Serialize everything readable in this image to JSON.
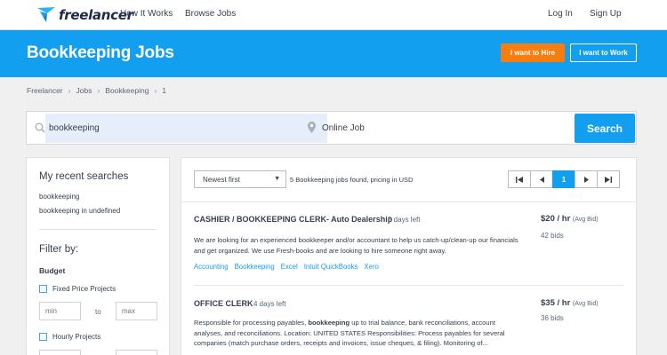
{
  "nav": {
    "logo_text": "freelancer",
    "links": [
      "How It Works",
      "Browse Jobs"
    ],
    "login": "Log In",
    "signup": "Sign Up"
  },
  "banner": {
    "title": "Bookkeeping Jobs",
    "hire_label": "I want to Hire",
    "work_label": "I want to Work"
  },
  "breadcrumb": [
    "Freelancer",
    "Jobs",
    "Bookkeeping",
    "1"
  ],
  "search": {
    "keyword_value": "bookkeeping",
    "location_value": "Online Job",
    "button_label": "Search"
  },
  "sidebar": {
    "recent_title": "My recent searches",
    "recent": [
      "bookkeeping",
      "bookkeeping in undefined"
    ],
    "filter_title": "Filter by:",
    "budget_label": "Budget",
    "fixed_label": "Fixed Price Projects",
    "hourly_label": "Hourly Projects",
    "min_placeholder": "min",
    "max_placeholder": "max",
    "to_label": "to"
  },
  "results": {
    "sort_value": "Newest first",
    "count_text": "5 Bookkeeping jobs found, pricing in USD",
    "pager": {
      "first": "⏮",
      "prev": "◀",
      "current": "1",
      "next": "▶",
      "last": "⏭"
    },
    "jobs": [
      {
        "title": "CASHIER / BOOKKEEPING CLERK- Auto Dealership",
        "days_left": "5 days left",
        "price": "$20 / hr",
        "avg": "(Avg Bid)",
        "bids": "42 bids",
        "desc": "We are looking for an experienced bookkeeper and/or accountant to help us catch-up/clean-up our financials and get organized. We use Fresh-books and are looking to hire someone right away.",
        "tags": [
          "Accounting",
          "Bookkeeping",
          "Excel",
          "Intuit QuickBooks",
          "Xero"
        ]
      },
      {
        "title": "OFFICE CLERK",
        "days_left": "4 days left",
        "price": "$35 / hr",
        "avg": "(Avg Bid)",
        "bids": "36 bids",
        "desc_pre": "Responsible for processing payables, ",
        "desc_bold": "bookkeeping",
        "desc_post": " up to trial balance, bank reconciliations, account analyses, and reconciliations. Location: UNITED STATES Responsibilities: Process payables for several companies (match purchase orders, receipts and invoices, issue cheques, & filing). Monitoring of..."
      }
    ]
  },
  "colors": {
    "brand_blue": "#139ff0",
    "hire_orange": "#f77d0e",
    "text": "#363f4d"
  }
}
